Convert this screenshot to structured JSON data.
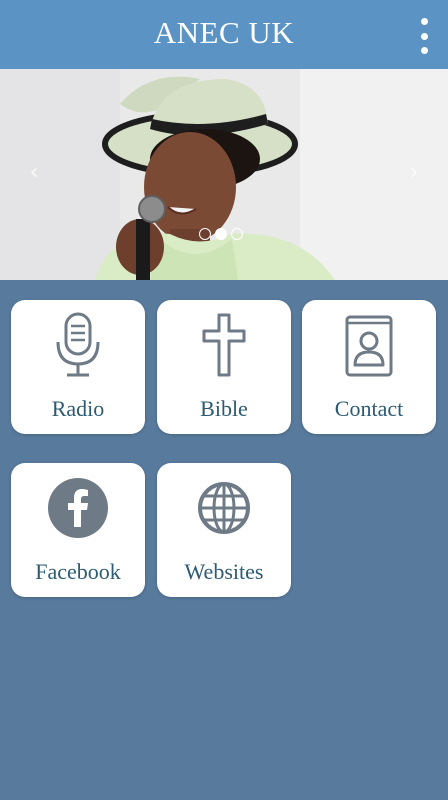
{
  "app": {
    "title": "ANEC UK"
  },
  "carousel": {
    "slide_count": 3,
    "active_index": 1
  },
  "tiles": [
    {
      "label": "Radio",
      "icon": "microphone-icon"
    },
    {
      "label": "Bible",
      "icon": "cross-icon"
    },
    {
      "label": "Contact",
      "icon": "contact-book-icon"
    },
    {
      "label": "Facebook",
      "icon": "facebook-icon"
    },
    {
      "label": "Websites",
      "icon": "globe-icon"
    }
  ],
  "colors": {
    "header": "#5b93c4",
    "background": "#587a9c",
    "tile_text": "#2c5b73",
    "icon": "#6e7a86"
  }
}
